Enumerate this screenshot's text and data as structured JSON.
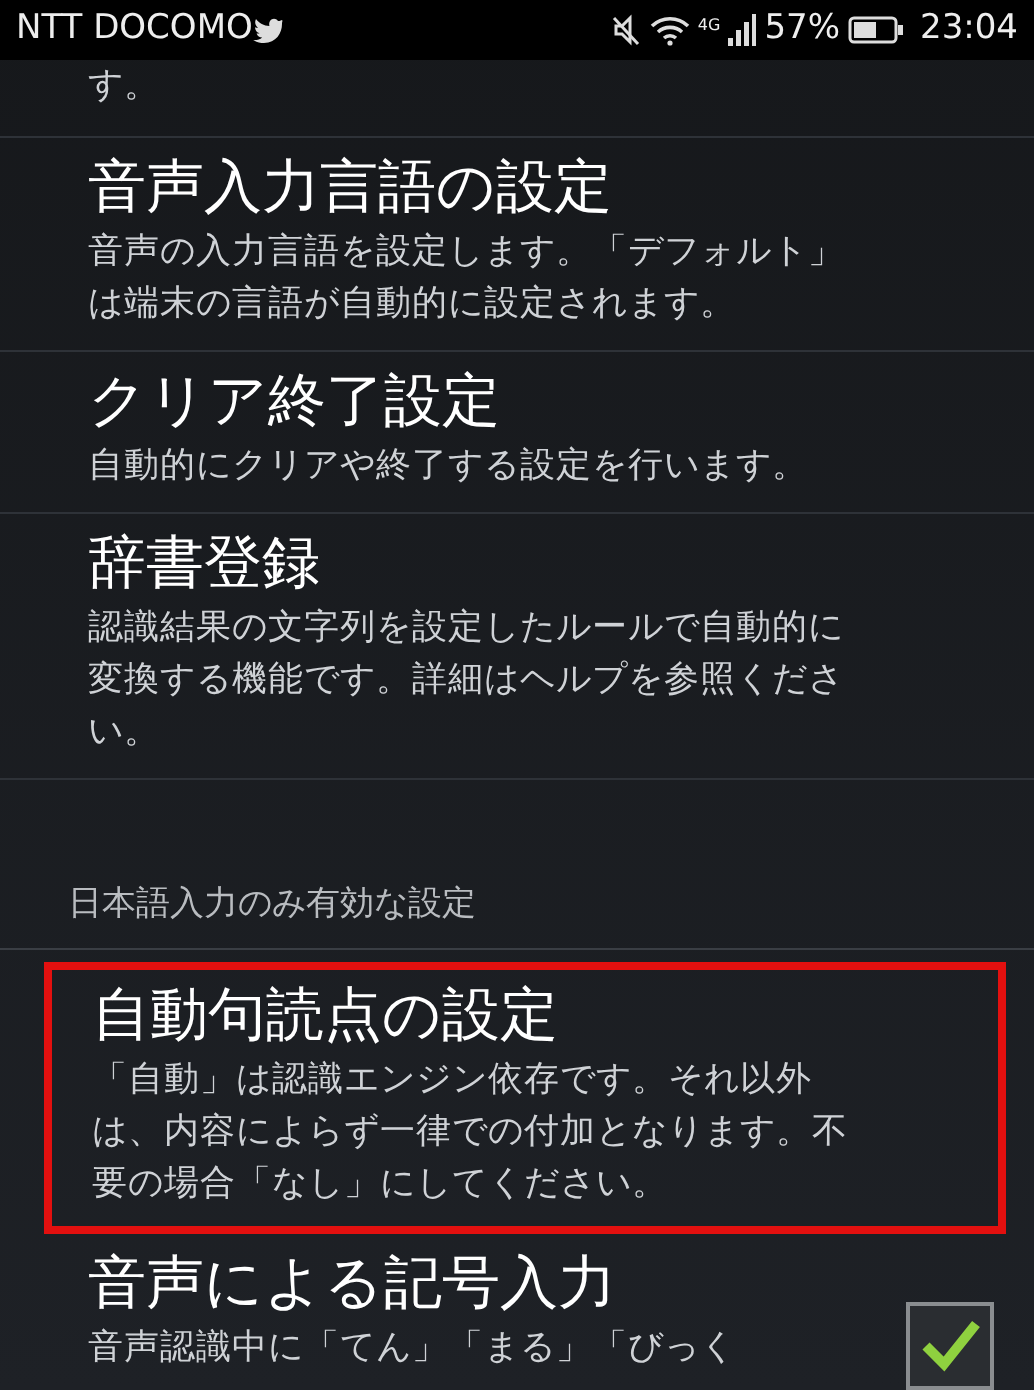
{
  "status_bar": {
    "carrier": "NTT DOCOMO",
    "network": "4G",
    "battery": "57%",
    "time": "23:04"
  },
  "items": [
    {
      "kind": "tail",
      "description": [
        "す。"
      ]
    },
    {
      "kind": "setting",
      "title": "音声入力言語の設定",
      "description": [
        "音声の入力言語を設定します。「デフォルト」",
        "は端末の言語が自動的に設定されます。"
      ]
    },
    {
      "kind": "setting",
      "title": "クリア終了設定",
      "description": [
        "自動的にクリアや終了する設定を行います。"
      ]
    },
    {
      "kind": "setting",
      "title": "辞書登録",
      "description": [
        "認識結果の文字列を設定したルールで自動的に",
        "変換する機能です。詳細はヘルプを参照くださ",
        "い。"
      ]
    },
    {
      "kind": "section",
      "title": "日本語入力のみ有効な設定"
    },
    {
      "kind": "setting",
      "highlighted": true,
      "title": "自動句読点の設定",
      "description": [
        "「自動」は認識エンジン依存です。それ以外",
        "は、内容によらず一律での付加となります。不",
        "要の場合「なし」にしてください。"
      ]
    },
    {
      "kind": "checkbox",
      "checked": true,
      "title": "音声による記号入力",
      "description": [
        "音声認識中に「てん」「まる」「びっく"
      ]
    }
  ]
}
